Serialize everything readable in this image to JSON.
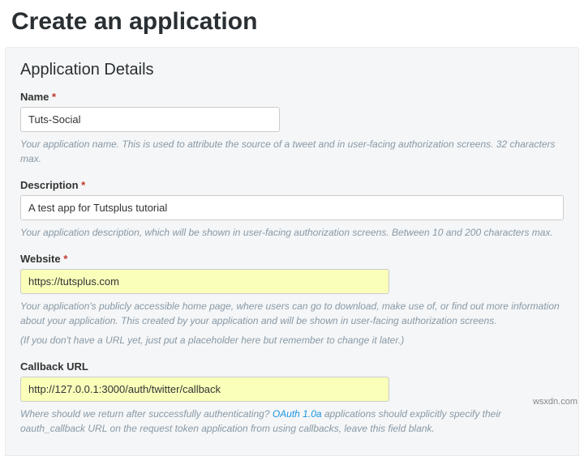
{
  "header": {
    "title": "Create an application"
  },
  "panel": {
    "heading": "Application Details"
  },
  "fields": {
    "name": {
      "label": "Name",
      "required": "*",
      "value": "Tuts-Social",
      "help": "Your application name. This is used to attribute the source of a tweet and in user-facing authorization screens. 32 characters max."
    },
    "description": {
      "label": "Description",
      "required": "*",
      "value": "A test app for Tutsplus tutorial",
      "help": "Your application description, which will be shown in user-facing authorization screens. Between 10 and 200 characters max."
    },
    "website": {
      "label": "Website",
      "required": "*",
      "value": "https://tutsplus.com",
      "help1": "Your application's publicly accessible home page, where users can go to download, make use of, or find out more information about your application. This created by your application and will be shown in user-facing authorization screens.",
      "help2": "(If you don't have a URL yet, just put a placeholder here but remember to change it later.)"
    },
    "callback": {
      "label": "Callback URL",
      "value": "http://127.0.0.1:3000/auth/twitter/callback",
      "help_before": "Where should we return after successfully authenticating? ",
      "help_link": "OAuth 1.0a",
      "help_after": " applications should explicitly specify their oauth_callback URL on the request token application from using callbacks, leave this field blank."
    }
  },
  "watermark": "wsxdn.com"
}
